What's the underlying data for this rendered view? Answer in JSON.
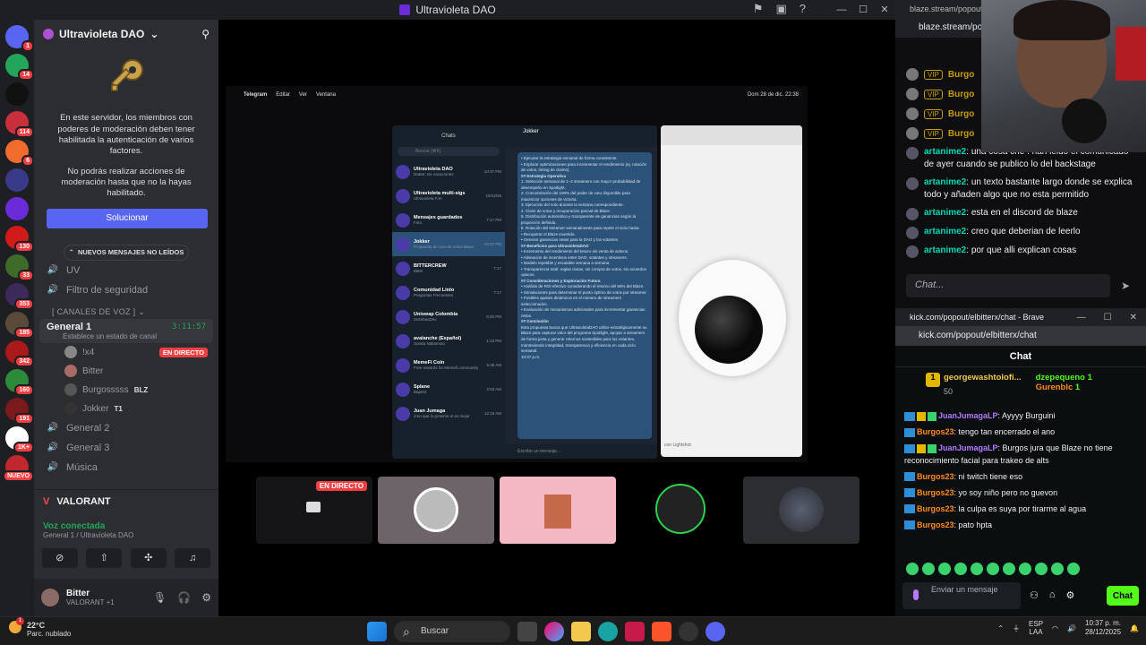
{
  "window_title": "Ultravioleta DAO",
  "servers": [
    {
      "color": "#5865f2",
      "badge": "1"
    },
    {
      "color": "#23a55a",
      "badge": "14"
    },
    {
      "color": "#111",
      "badge": ""
    },
    {
      "color": "#c92f3a",
      "badge": "114"
    },
    {
      "color": "#f06c2c",
      "badge": "6"
    },
    {
      "color": "#3a3a8a",
      "badge": ""
    },
    {
      "color": "#6c2bd9",
      "badge": ""
    },
    {
      "color": "#d11a1a",
      "badge": "130"
    },
    {
      "color": "#3e6b2a",
      "badge": "33"
    },
    {
      "color": "#3b2a5a",
      "badge": "353"
    },
    {
      "color": "#5a4a3a",
      "badge": "185"
    },
    {
      "color": "#aa1a1a",
      "badge": "342"
    },
    {
      "color": "#2d8a3a",
      "badge": "160"
    },
    {
      "color": "#7a1a1a",
      "badge": "191"
    },
    {
      "color": "#fff",
      "badge": "1K+"
    },
    {
      "color": "#c0282d",
      "badge": "NUEVO"
    }
  ],
  "guild": {
    "name": "Ultravioleta DAO",
    "mfa_text_1": "En este servidor, los miembros con poderes de moderación deben tener habilitada la autenticación de varios factores.",
    "mfa_text_2": "No podrás realizar acciones de moderación hasta que no la hayas habilitado.",
    "fix_button": "Solucionar",
    "new_unread": "NUEVOS MENSAJES NO LEÍDOS",
    "text_channels": [
      "UV",
      "Filtro de seguridad"
    ],
    "voice_category": "CANALES DE VOZ",
    "active_voice": {
      "name": "General 1",
      "timer": "3:11:57",
      "status": "Establece un estado de canal"
    },
    "members": [
      {
        "name": "!x4",
        "live": "EN DIRECTO",
        "color": "#888"
      },
      {
        "name": "Bitter",
        "live": "",
        "color": "#a86b65"
      },
      {
        "name": "Burgosssss",
        "tag": "BLZ",
        "live": "",
        "color": "#555"
      },
      {
        "name": "Jokker",
        "tag": "T1",
        "live": "",
        "color": "#333"
      }
    ],
    "other_voice": [
      "General 2",
      "General 3",
      "Música"
    ],
    "game": "VALORANT",
    "voice_connected": "Voz conectada",
    "voice_location": "General 1 / Ultravioleta DAO",
    "user": {
      "name": "Bitter",
      "activity": "VALORANT +1"
    }
  },
  "stream": {
    "mac_menu": [
      "Telegram",
      "Editar",
      "Ver",
      "Ventana"
    ],
    "mac_clock": "Dom 28 de dic. 22:38",
    "tg_title": "Telegram",
    "tg_chats_title": "Chats",
    "tg_search": "Buscar (⌘K)",
    "tg_chats": [
      {
        "name": "Ultravioleta DAO",
        "preview": "DaBot: De vacaciones",
        "time": "10:37 PM"
      },
      {
        "name": "Ultravioleta multi-sigs",
        "preview": "Ultravioleta FJA",
        "time": "10/12/25"
      },
      {
        "name": "Mensajes guardados",
        "preview": "Foto",
        "time": "7:17 PM"
      },
      {
        "name": "Jokker",
        "preview": "Propuesta de Uso de Votos Blaze",
        "time": "10:37 PM"
      },
      {
        "name": "BITTERCREW",
        "preview": "Bitter",
        "time": "7:17"
      },
      {
        "name": "Comunidad Linto",
        "preview": "Preguntas Frecuentes",
        "time": "7:17"
      },
      {
        "name": "Uniswap Colombia",
        "preview": "0xSebasDev",
        "time": "6:26 PM"
      },
      {
        "name": "avalanche (Español)",
        "preview": "Sorata Nakamoto",
        "time": "1:13 PM"
      },
      {
        "name": "MemeFi Coin",
        "preview": "Free rewards for Memefi community",
        "time": "5:38 AM"
      },
      {
        "name": "Splane",
        "preview": "Bapest",
        "time": "2:53 AM"
      },
      {
        "name": "Juan Jumaga",
        "preview": "creo que lo proxime el es mejor",
        "time": "12:16 AM"
      }
    ],
    "tg_contact": "Jokker",
    "tg_message": [
      "• Ejecutar la estrategia semanal de forma consistente.",
      "• Explorar optimizaciones para incrementar el rendimiento (ej. rotación de votos, timing de claims).",
      "## Estrategia Operativa",
      "1. Selección semanal de 1–2 streamers con mayor probabilidad de desempeño en Spotlight.",
      "2. Concentración del 100% del poder de voto disponible para maximizar opciones de victoria.",
      "3. Ejecución del voto durante la ventana correspondiente.",
      "4. Claim de votos y recuperación parcial de Blaze.",
      "5. Distribución automática y transparente de ganancias según la proporción definida.",
      "6. Rotación del streamer semanalmente para repetir el ciclo hasta:",
      "• Recuperar el Blaze invertido.",
      "• Generar ganancias netas para la DAO y los votantes.",
      "## Beneficios para UltravioletaDAO",
      "• Incremento del rendimiento del tesoro sin venta de activos.",
      "• Alineación de incentivos entre DAO, votantes y streamers.",
      "• Modelo repetible y escalable semana a semana.",
      "• Transparencia total: reglas claras, sin compra de votos, sin acuerdos opacos.",
      "## Consideraciones y Exploración Futura",
      "• Análisis de ROI efectivo considerando el retorno del 50% del Blaze.",
      "• Simulaciones para determinar el punto óptimo de votos por streamer.",
      "• Posibles ajustes dinámicos en el número de streamers seleccionados.",
      "• Evaluación de mecanismos adicionales para incrementar ganancias netas.",
      "## Conclusión",
      "Esta propuesta busca que UltravioletaDAO utilice estratégicamente su Blaze para capturar valor del programa Spotlight, apoyar a streamers de forma justa y generar retornos sostenibles para los votantes, manteniendo integridad, transparencia y eficiencia en cada ciclo semanal.",
      "10:37 p.m."
    ],
    "tg_input": "Escribe un mensaje...",
    "browser_caption": "con Lightshot",
    "thumb_live": "EN DIRECTO"
  },
  "blaze": {
    "tab_url": "blaze.stream/popout/",
    "url": "blaze.stream/pop",
    "vip_label": "VIP",
    "vip_names": [
      "Burgo",
      "Burgo",
      "Burgo",
      "Burgo"
    ],
    "messages": [
      {
        "user": "artanime2",
        "text": "una cosa che . han leido el comunicado de ayer cuando se publico lo del backstage"
      },
      {
        "user": "artanime2",
        "text": "un texto bastante largo donde se explica todo y añaden algo que no esta permitido"
      },
      {
        "user": "artanime2",
        "text": "esta en el discord de blaze"
      },
      {
        "user": "artanime2",
        "text": "creo que deberian de leerlo"
      },
      {
        "user": "artanime2",
        "text": "por que alli explican cosas"
      }
    ],
    "input_placeholder": "Chat..."
  },
  "kick": {
    "title": "kick.com/popout/elbitterx/chat - Brave",
    "url": "kick.com/popout/elbitterx/chat",
    "heading": "Chat",
    "top_gifter": {
      "rank": "1",
      "name": "georgewashtolofi...",
      "count": "50"
    },
    "side_gifters": [
      {
        "name": "dzepequeno",
        "count": "1"
      },
      {
        "name": "Gurenblc",
        "count": "1"
      }
    ],
    "messages": [
      {
        "user": "JuanJumagaLP",
        "text": "Ayyyy Burguini",
        "style": "u1",
        "badges": 3
      },
      {
        "user": "Burgos23",
        "text": "tengo tan encerrado el ano",
        "style": "u2",
        "badges": 1
      },
      {
        "user": "JuanJumagaLP",
        "text": "Burgos jura que Blaze no tiene reconocimiento facial para trakeo de alts",
        "style": "u1",
        "badges": 3
      },
      {
        "user": "Burgos23",
        "text": "ni twitch tiene eso",
        "style": "u2",
        "badges": 1
      },
      {
        "user": "Burgos23",
        "text": "yo soy niño pero no guevon",
        "style": "u2",
        "badges": 1
      },
      {
        "user": "Burgos23",
        "text": "la culpa es suya por tirarme al agua",
        "style": "u2",
        "badges": 1
      },
      {
        "user": "Burgos23",
        "text": "pato hpta",
        "style": "u2",
        "badges": 1
      }
    ],
    "input_placeholder": "Enviar un mensaje",
    "chat_button": "Chat"
  },
  "taskbar": {
    "temp": "22°C",
    "weather": "Parc. nublado",
    "weather_badge": "1",
    "search": "Buscar",
    "lang_1": "ESP",
    "lang_2": "LAA",
    "time": "10:37 p. m.",
    "date": "28/12/2025"
  }
}
